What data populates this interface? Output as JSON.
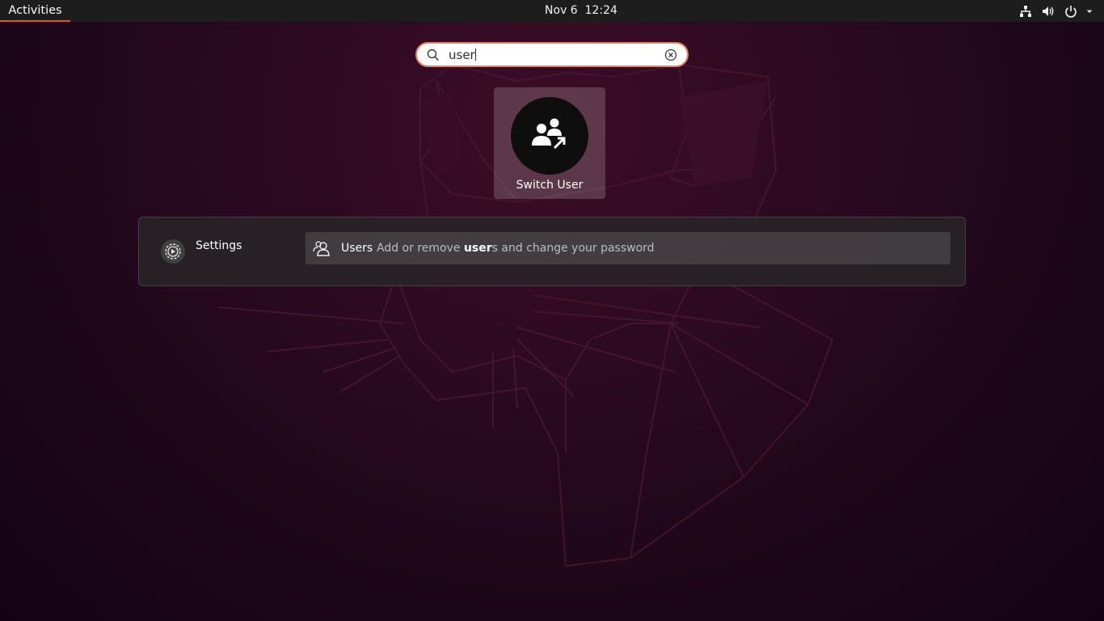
{
  "topbar": {
    "activities_label": "Activities",
    "clock": "Nov 6  12:24",
    "tray_icons": [
      "network-icon",
      "volume-icon",
      "power-icon",
      "chevron-down-icon"
    ]
  },
  "search": {
    "value": "user",
    "search_icon": "search-icon",
    "clear_icon": "clear-icon"
  },
  "app_results": [
    {
      "label": "Switch User",
      "icon": "switch-user-icon"
    }
  ],
  "search_results": {
    "provider": {
      "name": "Settings",
      "icon": "settings-icon"
    },
    "items": [
      {
        "title": "Users",
        "icon": "users-icon",
        "description_before": "Add or remove ",
        "description_highlight": "user",
        "description_after": "s and change your password"
      }
    ]
  },
  "colors": {
    "accent": "#e95420",
    "topbar_bg": "#1d1d1d",
    "search_border": "#e2826a"
  }
}
